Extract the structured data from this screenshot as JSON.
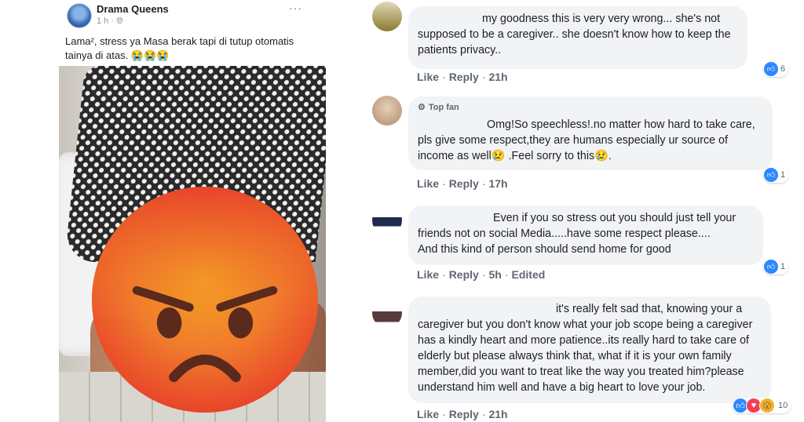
{
  "post": {
    "page_name": "Drama Queens",
    "time": "1 h",
    "meta_sep": "·",
    "options": "···",
    "caption": "Lama², stress ya Masa berak tapi di tutup otomatis tainya di atas. 😭😭😭"
  },
  "comments": [
    {
      "lines": [
        "my goodness this is very very wrong... she's not",
        "supposed to be a caregiver.. she doesn't know how to keep the",
        "patients privacy.."
      ],
      "actions": {
        "like": "Like",
        "reply": "Reply",
        "time": "21h",
        "edited": ""
      },
      "reaction_count": "6",
      "top_fan": ""
    },
    {
      "lines": [
        "Omg!So speechless!.no matter how hard to take care,",
        "pls give some respect,they are humans especially ur source of",
        "income as well😢 .Feel sorry to this😢."
      ],
      "actions": {
        "like": "Like",
        "reply": "Reply",
        "time": "17h",
        "edited": ""
      },
      "reaction_count": "1",
      "top_fan": "Top fan"
    },
    {
      "lines": [
        "Even if you so stress out you should just tell your",
        "friends not on social Media.....have some respect please....",
        "And this kind of person should send home for good"
      ],
      "actions": {
        "like": "Like",
        "reply": "Reply",
        "time": "5h",
        "edited": "Edited"
      },
      "reaction_count": "1",
      "top_fan": ""
    },
    {
      "lines": [
        "it's really felt sad that, knowing your a",
        "caregiver but you don't know what your job scope being a caregiver",
        "has a kindly heart and more patience..its really hard to take care of",
        "elderly but please always think that, what if it is your own family",
        "member,did you want to treat like the way you treated him?please",
        "understand him well and have a big heart to love your job."
      ],
      "actions": {
        "like": "Like",
        "reply": "Reply",
        "time": "21h",
        "edited": ""
      },
      "reaction_count": "10",
      "top_fan": ""
    }
  ],
  "icons": {
    "like": "thumbs-up-icon",
    "angry_overlay": "angry-face-emoji",
    "top_fan": "top-fan-badge-icon"
  },
  "colors": {
    "facebook_blue": "#2d88ff",
    "bubble_bg": "#f2f3f5",
    "action_gray": "#606770",
    "angry_red": "#e8452a",
    "angry_orange": "#f5a623"
  }
}
